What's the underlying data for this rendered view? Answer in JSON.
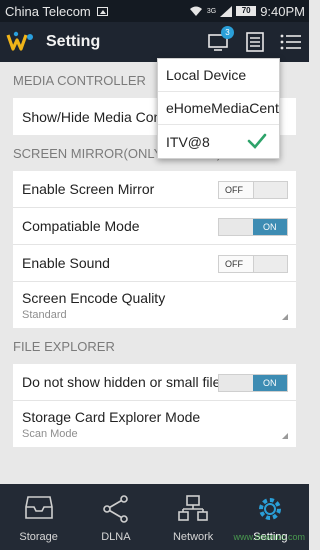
{
  "status_bar": {
    "carrier": "China Telecom",
    "network": "3G",
    "battery": "70",
    "time": "9:40PM"
  },
  "app_bar": {
    "title": "Setting",
    "badge_count": "3",
    "icons": [
      "device-screen-icon",
      "list-document-icon",
      "menu-icon"
    ]
  },
  "sections": {
    "media_controller": {
      "header": "MEDIA CONTROLLER",
      "show_hide_label": "Show/Hide Media Controller"
    },
    "screen_mirror": {
      "header": "SCREEN MIRROR(Only for ITV)",
      "enable_mirror": {
        "label": "Enable Screen Mirror",
        "state": "OFF"
      },
      "compatible_mode": {
        "label": "Compatiable Mode",
        "state": "ON"
      },
      "enable_sound": {
        "label": "Enable Sound",
        "state": "OFF"
      },
      "encode_quality": {
        "label": "Screen Encode Quality",
        "value": "Standard"
      }
    },
    "file_explorer": {
      "header": "FILE EXPLORER",
      "hidden_files": {
        "label": "Do not show hidden or small files",
        "state": "ON"
      },
      "storage_mode": {
        "label": "Storage Card Explorer Mode",
        "value": "Scan Mode"
      }
    }
  },
  "toggle_labels": {
    "on": "ON",
    "off": "OFF"
  },
  "device_menu": {
    "items": [
      "Local Device",
      "eHomeMediaCenter",
      "ITV@8"
    ],
    "selected": "ITV@8",
    "check_color": "#2ea36a"
  },
  "bottom_nav": {
    "items": [
      {
        "label": "Storage",
        "icon": "storage-tray-icon"
      },
      {
        "label": "DLNA",
        "icon": "share-nodes-icon"
      },
      {
        "label": "Network",
        "icon": "network-icon"
      },
      {
        "label": "Setting",
        "icon": "gear-icon"
      }
    ],
    "active": "Setting"
  },
  "watermark": "www.downcc.com",
  "colors": {
    "status_bar": "#141a22",
    "app_bar": "#1e2530",
    "bottom_nav": "#232a35",
    "toggle_on": "#3d8cb3",
    "badge": "#2a9fd8"
  }
}
